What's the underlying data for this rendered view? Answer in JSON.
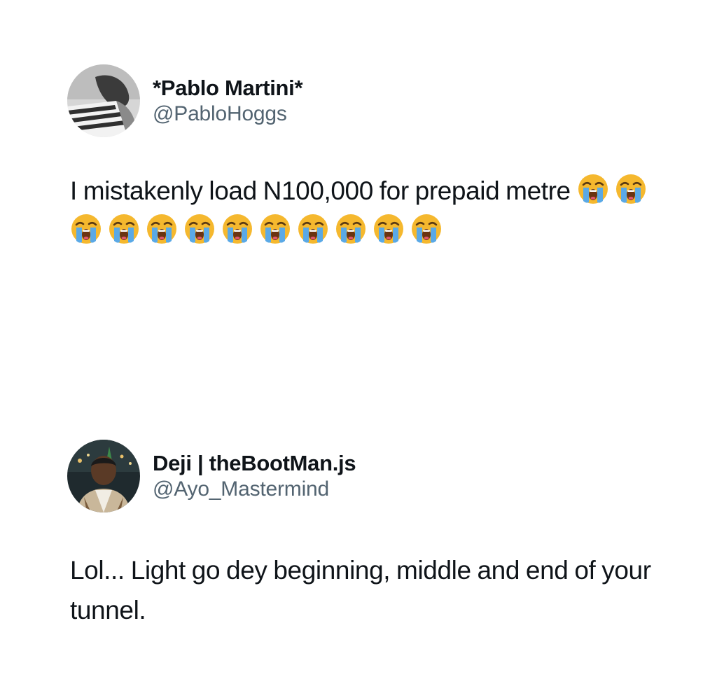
{
  "tweets": [
    {
      "author": {
        "display_name": "*Pablo Martini*",
        "handle": "@PabloHoggs",
        "avatar_icon": "user-avatar-photo"
      },
      "text": "I mistakenly load N100,000 for prepaid metre",
      "emoji": {
        "name": "loudly-crying-face-icon",
        "count": 12
      }
    },
    {
      "author": {
        "display_name": "Deji | theBootMan.js",
        "handle": "@Ayo_Mastermind",
        "avatar_icon": "user-avatar-photo"
      },
      "text": "Lol... Light go dey beginning, middle and end of your tunnel."
    }
  ],
  "colors": {
    "text_primary": "#0f1419",
    "text_secondary": "#536471",
    "background": "#ffffff",
    "emoji_face": "#f5b82e",
    "emoji_tears": "#5aa9e6"
  }
}
